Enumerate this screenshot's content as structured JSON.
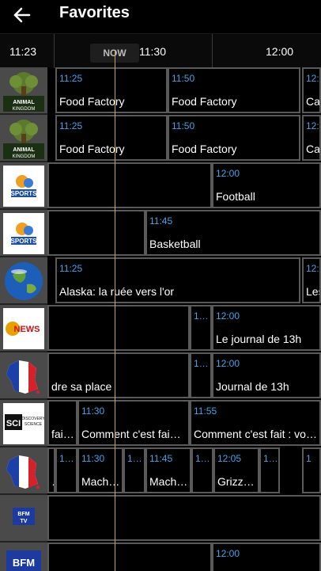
{
  "header": {
    "title": "Favorites",
    "back_icon": "arrow-left-icon"
  },
  "timebar": {
    "t1": "11:23",
    "t2": "11:30",
    "t3": "12:00",
    "now_label": "NOW"
  },
  "channels": [
    {
      "logo_icon": "animal-kingdom-logo",
      "logo_text": "ANIMAL KINGDOM",
      "programs": [
        {
          "time": "11:25",
          "name": "Food Factory"
        },
        {
          "time": "11:50",
          "name": "Food Factory"
        },
        {
          "time": "12:",
          "name": "Ca"
        }
      ]
    },
    {
      "logo_icon": "animal-kingdom-logo",
      "logo_text": "ANIMAL KINGDOM",
      "programs": [
        {
          "time": "11:25",
          "name": "Food Factory"
        },
        {
          "time": "11:50",
          "name": "Food Factory"
        },
        {
          "time": "12:",
          "name": "Ca"
        }
      ]
    },
    {
      "logo_icon": "sports-logo",
      "logo_text": "SPORTS",
      "programs": [
        {
          "time": "",
          "name": ""
        },
        {
          "time": "12:00",
          "name": "Football"
        }
      ]
    },
    {
      "logo_icon": "sports-logo",
      "logo_text": "SPORTS",
      "programs": [
        {
          "time": "",
          "name": ""
        },
        {
          "time": "11:45",
          "name": "Basketball"
        }
      ]
    },
    {
      "logo_icon": "earth-logo",
      "logo_text": "",
      "programs": [
        {
          "time": "11:25",
          "name": "Alaska: la ruée vers l'or"
        },
        {
          "time": "12:",
          "name": "Les"
        }
      ]
    },
    {
      "logo_icon": "news-logo",
      "logo_text": "NEWS",
      "programs": [
        {
          "time": "",
          "name": ""
        },
        {
          "time": "1…",
          "name": ""
        },
        {
          "time": "12:00",
          "name": "Le journal de 13h"
        }
      ]
    },
    {
      "logo_icon": "france-map-logo",
      "logo_text": "",
      "programs": [
        {
          "time": "",
          "name": "dre sa place"
        },
        {
          "time": "1…",
          "name": ""
        },
        {
          "time": "12:00",
          "name": "Journal de 13h"
        }
      ]
    },
    {
      "logo_icon": "sci-logo",
      "logo_text": "SCI",
      "programs": [
        {
          "time": "",
          "name": "fai…"
        },
        {
          "time": "11:30",
          "name": "Comment c'est fai…"
        },
        {
          "time": "11:55",
          "name": "Comment c'est fait : vo…"
        }
      ]
    },
    {
      "logo_icon": "france-map-logo",
      "logo_text": "",
      "programs": [
        {
          "time": "",
          "name": "…"
        },
        {
          "time": "1…",
          "name": ""
        },
        {
          "time": "11:30",
          "name": "Mach…"
        },
        {
          "time": "1…",
          "name": ""
        },
        {
          "time": "11:45",
          "name": "Mach…"
        },
        {
          "time": "1…",
          "name": ""
        },
        {
          "time": "12:05",
          "name": "Grizz…"
        },
        {
          "time": "1…",
          "name": ""
        },
        {
          "time": "1",
          "name": ""
        }
      ]
    },
    {
      "logo_icon": "bfm-tv-logo",
      "logo_text": "BFM TV",
      "programs": [
        {
          "time": "",
          "name": ""
        }
      ]
    },
    {
      "logo_icon": "bfm-business-logo",
      "logo_text": "BFM BUSINESS",
      "programs": [
        {
          "time": "",
          "name": ""
        },
        {
          "time": "12:00",
          "name": ""
        }
      ]
    }
  ],
  "colors": {
    "time_text": "#3ea6ea",
    "now_line": "#c9a24a",
    "cell_border": "#5a5a5a"
  }
}
